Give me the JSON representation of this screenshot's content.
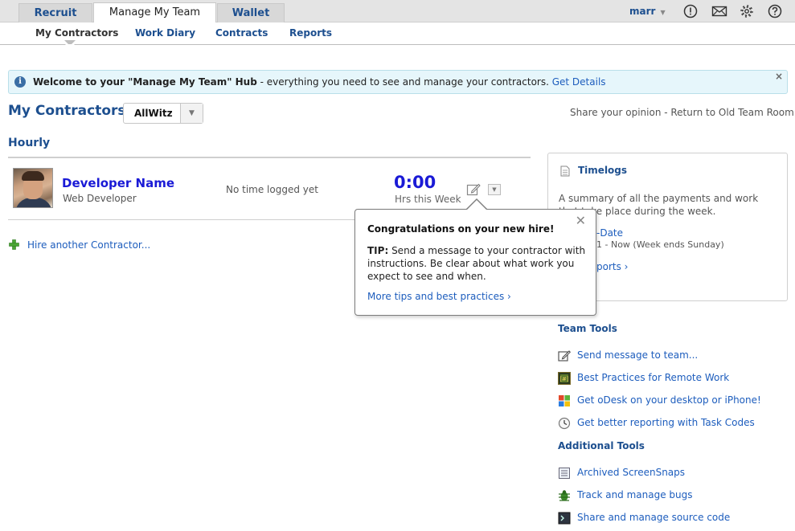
{
  "tabs": [
    {
      "label": "Recruit"
    },
    {
      "label": "Manage My Team"
    },
    {
      "label": "Wallet"
    }
  ],
  "user": {
    "name": "marr"
  },
  "icons": {
    "alert": "alert-circle-icon",
    "messages": "envelope-icon",
    "settings": "gear-icon",
    "help": "help-circle-icon"
  },
  "subnav": [
    {
      "label": "My Contractors"
    },
    {
      "label": "Work Diary"
    },
    {
      "label": "Contracts"
    },
    {
      "label": "Reports"
    }
  ],
  "banner": {
    "bold": "Welcome to your \"Manage My Team\" Hub",
    "text": " - everything you need to see and manage your contractors. ",
    "link": "Get Details",
    "close": "×"
  },
  "contractors": {
    "heading": "My Contractors",
    "team_selected": "AllWitz",
    "links": "Share your opinion - Return to Old Team Room",
    "section": "Hourly",
    "row": {
      "name": "Developer Name",
      "title": "Web Developer",
      "status": "No time logged yet",
      "hours": "0:00",
      "hours_label": "Hrs this Week"
    },
    "hire_link": "Hire another Contractor..."
  },
  "popover": {
    "title": "Congratulations on your new hire!",
    "tip_label": "TIP:",
    "tip_text": " Send a message to your contractor with instructions. Be clear about what work you expect to see and when.",
    "link": "More tips and best practices ›",
    "close": "✕"
  },
  "timelogs": {
    "title": "Timelogs",
    "desc": "A summary of all the payments and work that take place during the week.",
    "link1": "-Date",
    "sub": "1 - Now (Week ends Sunday)",
    "link2": "ports ›"
  },
  "team_tools": {
    "heading": "Team Tools",
    "items": [
      {
        "label": "Send message to team...",
        "icon": "compose-icon"
      },
      {
        "label": "Best Practices for Remote Work",
        "icon": "best-practices-icon"
      },
      {
        "label": "Get oDesk on your desktop or iPhone!",
        "icon": "windows-icon"
      },
      {
        "label": "Get better reporting with Task Codes",
        "icon": "clock-icon"
      }
    ]
  },
  "additional_tools": {
    "heading": "Additional Tools",
    "items": [
      {
        "label": "Archived ScreenSnaps",
        "icon": "archive-icon"
      },
      {
        "label": "Track and manage bugs",
        "icon": "bug-icon"
      },
      {
        "label": "Share and manage source code",
        "icon": "terminal-icon"
      }
    ]
  },
  "colors": {
    "brand_blue": "#1d4f8f",
    "link_blue": "#1d5dbd",
    "name_blue": "#1a1ad6",
    "banner_bg": "#e6f6fb"
  }
}
